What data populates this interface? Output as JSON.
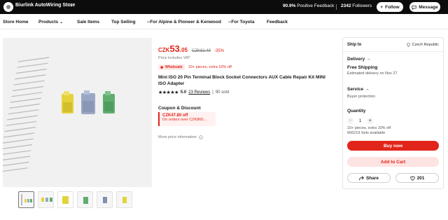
{
  "store": {
    "name": "Biurlink AutoWiring Store",
    "feedback_pct": "90.9%",
    "feedback_label": "Positive Feedback",
    "followers_count": "2342",
    "followers_label": "Followers",
    "follow_label": "Follow",
    "message_label": "Message"
  },
  "nav": {
    "items": [
      {
        "label": "Store Home"
      },
      {
        "label": "Products"
      },
      {
        "label": "Sale Items"
      },
      {
        "label": "Top Selling"
      },
      {
        "label": "--For Alpine & Pioneer & Kenwood"
      },
      {
        "label": "--For Toyota"
      },
      {
        "label": "Feedback"
      }
    ]
  },
  "product": {
    "currency": "CZK",
    "price_int": "53",
    "price_dec": ".05",
    "old_price": "CZK81.49",
    "discount": "-35%",
    "vat_note": "Price includes VAT",
    "wholesale_tag": "Wholesale",
    "wholesale_text": "10+ pieces, extra 10% off",
    "title": "Mini ISO 20 Pin Terminal Block Socket Connectors AUX Cable Repair Kit MINI ISO Adapter",
    "stars": "★★★★★",
    "rating": "5.0",
    "reviews": "23 Reviews",
    "sold": "90 sold",
    "coupon_title": "Coupon & Discount",
    "coupon_amount": "CZK47.80 off",
    "coupon_condition": "On orders over CZK860...",
    "more_info": "More price information"
  },
  "panel": {
    "ship_to_label": "Ship to",
    "ship_country": "Czech Republic",
    "delivery_label": "Delivery",
    "free_shipping": "Free Shipping",
    "estimated": "Estimated delivery on Nov 27",
    "service_label": "Service",
    "buyer_protection": "Buyer protection",
    "quantity_label": "Quantity",
    "quantity_value": "1",
    "minus": "−",
    "plus": "+",
    "extra_note": "10+ pieces, extra 10% off",
    "available": "666219 Sets available",
    "buy_now": "Buy now",
    "add_to_cart": "Add to Cart",
    "share": "Share",
    "wishlist_count": "201"
  },
  "colors": {
    "accent": "#e1251b",
    "accent_light": "#fde3e1",
    "connector_yellow": "#e4d23a",
    "connector_blue": "#9aa7c4",
    "connector_green": "#5fae6e"
  },
  "icons": [
    "store-logo-icon",
    "chevron-right-icon",
    "plus-icon",
    "chat-icon",
    "chevron-down-icon",
    "location-pin-icon",
    "info-icon",
    "share-icon",
    "heart-icon",
    "tag-icon"
  ]
}
